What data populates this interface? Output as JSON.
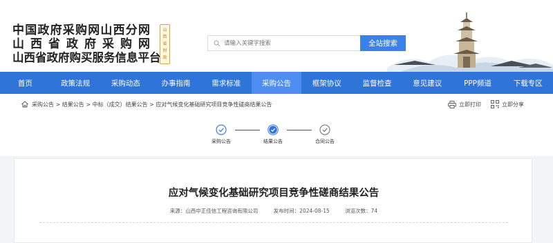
{
  "header": {
    "logo_lines": [
      "中国政府采购网山西分网",
      "山西省政府采购网",
      "山西省政府购买服务信息平台"
    ],
    "seal_text": [
      "山",
      "西",
      "省",
      "财",
      "政",
      "厅"
    ],
    "search_placeholder": "请输入关键字搜索",
    "search_button": "全站搜索"
  },
  "nav": {
    "items": [
      "首页",
      "政策法规",
      "采购动态",
      "办事指南",
      "需求标准",
      "采购公告",
      "框架协议",
      "监督检查",
      "意见建议",
      "PPP频道",
      "下载专区"
    ],
    "active_index": 5
  },
  "breadcrumb": {
    "text": "采购公告 > 结果公告 > 中标（成交）结果公告 > 应对气候变化基础研究项目竞争性磋商结果公告",
    "print_label": "立即打印",
    "share_label": "立即分享"
  },
  "steps": {
    "items": [
      {
        "label": "采购公告",
        "state": "done"
      },
      {
        "label": "结果公告",
        "state": "current"
      },
      {
        "label": "合同公告",
        "state": "todo"
      }
    ]
  },
  "article": {
    "title": "应对气候变化基础研究项目竞争性磋商结果公告",
    "source": "来源：山西中正佳信工程咨询有限公司",
    "publish_time": "发布时间：2024-08-15",
    "views": "浏览次数：74"
  },
  "colors": {
    "nav_bg": "#2f74d8",
    "nav_active": "#4e8ef0",
    "accent": "#3b82e6"
  }
}
